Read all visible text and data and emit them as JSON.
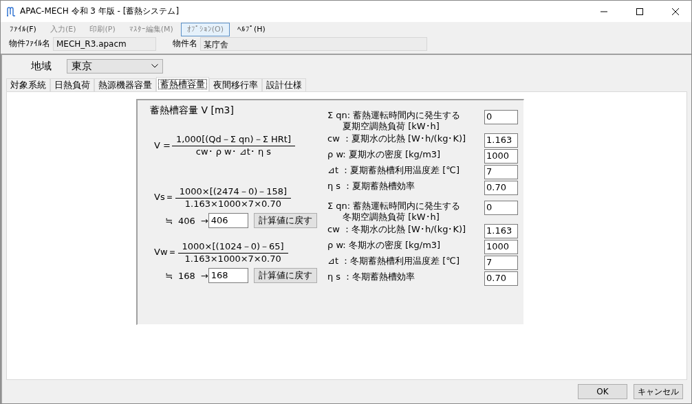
{
  "window": {
    "title": "APAC-MECH 令和 3 年版 - [蓄熱システム]"
  },
  "menu": [
    {
      "label": "ﾌｧｲﾙ(F)",
      "disabled": false,
      "highlighted": false
    },
    {
      "label": "入力(E)",
      "disabled": true,
      "highlighted": false
    },
    {
      "label": "印刷(P)",
      "disabled": true,
      "highlighted": false
    },
    {
      "label": "ﾏｽﾀｰ編集(M)",
      "disabled": true,
      "highlighted": false
    },
    {
      "label": "ｵﾌﾟｼｮﾝ(O)",
      "disabled": true,
      "highlighted": true
    },
    {
      "label": "ﾍﾙﾌﾟ(H)",
      "disabled": false,
      "highlighted": false
    }
  ],
  "info": [
    {
      "label": "物件ﾌｧｲﾙ名",
      "value": "MECH_R3.apacm"
    },
    {
      "label": "物件名",
      "value": "某庁舎"
    }
  ],
  "region": {
    "label": "地域",
    "value": "東京"
  },
  "tabs": [
    {
      "label": "対象系統",
      "selected": false
    },
    {
      "label": "日熱負荷",
      "selected": false
    },
    {
      "label": "熱源機器容量",
      "selected": false
    },
    {
      "label": "蓄熱槽容量",
      "selected": true
    },
    {
      "label": "夜間移行率",
      "selected": false
    },
    {
      "label": "設計仕様",
      "selected": false
    }
  ],
  "heading": "蓄熱槽容量 V [m3]",
  "formulas": [
    {
      "kind": "formula",
      "lhs": "V =",
      "numerator": "1,000[(Qd－Σ qn)－Σ HRt]",
      "denominator": "cw･ ρ w･ ⊿t･ η s"
    },
    {
      "kind": "calc",
      "lhs": "Vs＝",
      "numerator": "1000×[(2474－0)－158]",
      "denominator": "1.163×1000×7×0.70",
      "approx": "≒",
      "result": "406",
      "arrow": "→",
      "value": "406",
      "button": "計算値に戻す"
    },
    {
      "kind": "calc",
      "lhs": "Vw＝",
      "numerator": "1000×[(1024－0)－65]",
      "denominator": "1.163×1000×7×0.70",
      "approx": "≒",
      "result": "168",
      "arrow": "→",
      "value": "168",
      "button": "計算値に戻す"
    }
  ],
  "parameter_groups": [
    {
      "params": [
        {
          "lines": [
            "Σ qn: 蓄熱運転時間内に発生する",
            "夏期空調熱負荷 [kW･h]"
          ],
          "value": "0"
        },
        {
          "lines": [
            "cw ：夏期水の比熱 [W･h/(kg･K)]"
          ],
          "value": "1.163"
        },
        {
          "lines": [
            "ρ w: 夏期水の密度 [kg/m3]"
          ],
          "value": "1000"
        },
        {
          "lines": [
            "⊿t ：夏期蓄熱槽利用温度差 [℃]"
          ],
          "value": "7"
        },
        {
          "lines": [
            "η s ：夏期蓄熱槽効率"
          ],
          "value": "0.70"
        }
      ]
    },
    {
      "params": [
        {
          "lines": [
            "Σ qn: 蓄熱運転時間内に発生する",
            "冬期空調熱負荷 [kW･h]"
          ],
          "value": "0"
        },
        {
          "lines": [
            "cw ：冬期水の比熱 [W･h/(kg･K)]"
          ],
          "value": "1.163"
        },
        {
          "lines": [
            "ρ w: 冬期水の密度 [kg/m3]"
          ],
          "value": "1000"
        },
        {
          "lines": [
            "⊿t ：冬期蓄熱槽利用温度差 [℃]"
          ],
          "value": "7"
        },
        {
          "lines": [
            "η s ：冬期蓄熱槽効率"
          ],
          "value": "0.70"
        }
      ]
    }
  ],
  "buttons": [
    "OK",
    "キャンセル"
  ]
}
